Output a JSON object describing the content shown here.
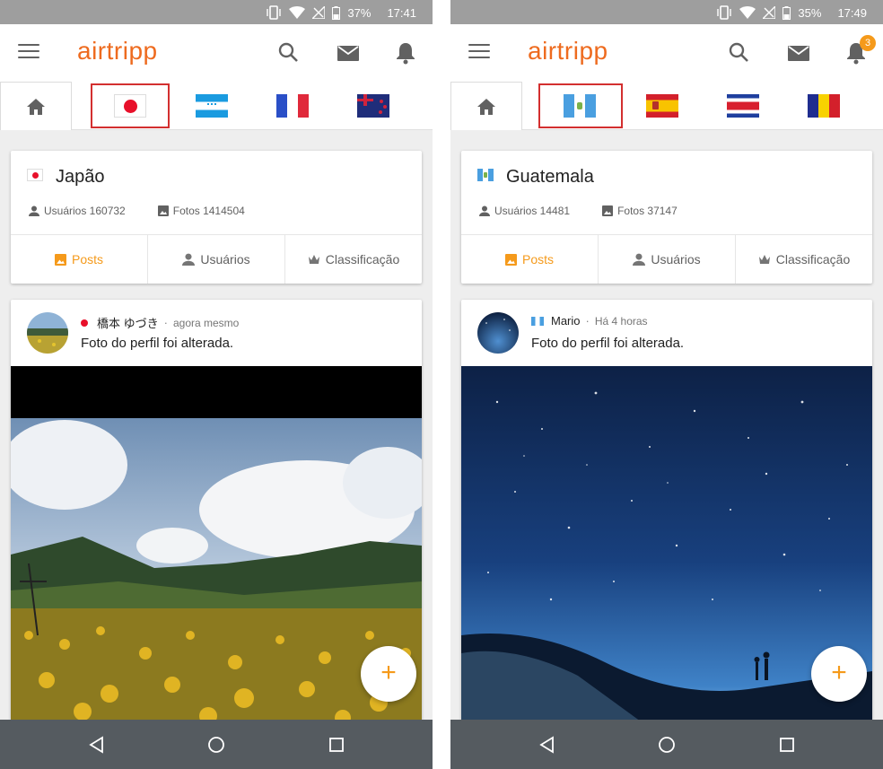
{
  "screens": [
    {
      "status": {
        "battery": "37%",
        "time": "17:41"
      },
      "app": {
        "logo": "airtripp"
      },
      "notifications_badge": "",
      "tabs": [
        "home-icon",
        "japan-flag",
        "honduras-flag",
        "france-flag",
        "new-zealand-flag"
      ],
      "country": {
        "name": "Japão",
        "users_label": "Usuários 160732",
        "photos_label": "Fotos 1414504"
      },
      "buttons": {
        "posts": "Posts",
        "users": "Usuários",
        "ranking": "Classificação"
      },
      "post": {
        "author": "橋本 ゆづき",
        "time": "agora mesmo",
        "text": "Foto do perfil foi alterada."
      },
      "fab": "+"
    },
    {
      "status": {
        "battery": "35%",
        "time": "17:49"
      },
      "app": {
        "logo": "airtripp"
      },
      "notifications_badge": "3",
      "tabs": [
        "home-icon",
        "guatemala-flag",
        "spain-flag",
        "costa-rica-flag",
        "romania-flag"
      ],
      "country": {
        "name": "Guatemala",
        "users_label": "Usuários 14481",
        "photos_label": "Fotos 37147"
      },
      "buttons": {
        "posts": "Posts",
        "users": "Usuários",
        "ranking": "Classificação"
      },
      "post": {
        "author": "Mario",
        "time": "Há 4 horas",
        "text": "Foto do perfil foi alterada."
      },
      "fab": "+"
    }
  ],
  "colors": {
    "brand": "#ee6b1f",
    "accent": "#f59a1b",
    "highlight": "#d32f2f"
  }
}
